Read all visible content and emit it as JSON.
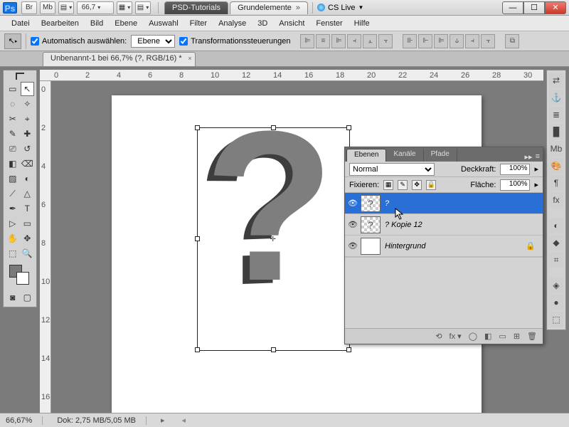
{
  "titlebar": {
    "app": "Ps",
    "br": "Br",
    "mb": "Mb",
    "zoom": "66,7",
    "tabs": [
      {
        "label": "PSD-Tutorials",
        "dark": true
      },
      {
        "label": "Grundelemente",
        "dark": false
      }
    ],
    "cslive": "CS Live"
  },
  "menu": [
    "Datei",
    "Bearbeiten",
    "Bild",
    "Ebene",
    "Auswahl",
    "Filter",
    "Analyse",
    "3D",
    "Ansicht",
    "Fenster",
    "Hilfe"
  ],
  "options": {
    "auto_select_label": "Automatisch auswählen:",
    "auto_select_value": "Ebene",
    "transform_label": "Transformationssteuerungen",
    "auto_checked": true,
    "transform_checked": true
  },
  "document": {
    "tab": "Unbenannt-1 bei 66,7% (?, RGB/16) *"
  },
  "ruler_h": [
    0,
    2,
    4,
    6,
    8,
    10,
    12,
    14,
    16,
    18,
    20,
    22,
    24,
    26,
    28,
    30
  ],
  "ruler_v": [
    0,
    2,
    4,
    6,
    8,
    10,
    12,
    14,
    16
  ],
  "layers_panel": {
    "tabs": [
      "Ebenen",
      "Kanäle",
      "Pfade"
    ],
    "blend": "Normal",
    "opacity_label": "Deckkraft:",
    "opacity": "100%",
    "lock_label": "Fixieren:",
    "fill_label": "Fläche:",
    "fill": "100%",
    "layers": [
      {
        "name": "?",
        "visible": true,
        "selected": true,
        "thumb": "?"
      },
      {
        "name": "? Kopie 12",
        "visible": true,
        "selected": false,
        "thumb": "?"
      },
      {
        "name": "Hintergrund",
        "visible": true,
        "selected": false,
        "thumb": "",
        "bgwhite": true,
        "locked": true
      }
    ],
    "footer_icons": [
      "⟲",
      "fx ▾",
      "◯",
      "◧",
      "▭",
      "⊞",
      "🗑"
    ]
  },
  "status": {
    "zoom": "66,67%",
    "doc": "Dok: 2,75 MB/5,05 MB"
  },
  "tool_icons": [
    "▭",
    "↖",
    "◌",
    "✧",
    "✂",
    "⌖",
    "✎",
    "✚",
    "⎚",
    "↺",
    "◧",
    "⌫",
    "▨",
    "◐",
    "⟋",
    "△",
    "✒",
    "T",
    "▷",
    "▭",
    "✋",
    "✥",
    "⬚",
    "🔍"
  ],
  "right_icons": [
    "⇄",
    "⚓",
    "≣",
    "█",
    "Mb",
    "🎨",
    "¶",
    "fx",
    "",
    "◐",
    "◆",
    "⌗",
    "",
    "◈",
    "●",
    "⬚"
  ]
}
